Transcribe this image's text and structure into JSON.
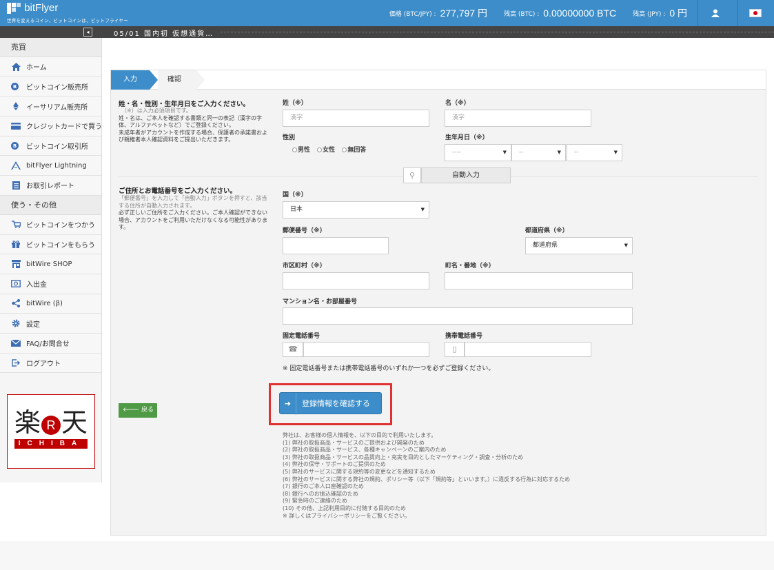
{
  "header": {
    "brand": "bitFlyer",
    "tagline": "世界を変えるコイン、ビットコインは、ビットフライヤー",
    "price_label": "価格 (BTC/JPY) :",
    "price_value": "277,797 円",
    "btc_balance_label": "残高 (BTC) :",
    "btc_balance_value": "0.00000000 BTC",
    "jpy_balance_label": "残高 (JPY) :",
    "jpy_balance_value": "0 円",
    "accent_color": "#3c8dc9"
  },
  "ticker": {
    "toggle_glyph": "◂",
    "text": "05/01 国内初 仮想通貨…"
  },
  "sidebar": {
    "section_trade": "売買",
    "trade_items": [
      {
        "label": "ホーム",
        "icon": "home-icon"
      },
      {
        "label": "ビットコイン販売所",
        "icon": "bitcoin-icon"
      },
      {
        "label": "イーサリアム販売所",
        "icon": "ethereum-icon"
      },
      {
        "label": "クレジットカードで買う",
        "icon": "credit-card-icon"
      },
      {
        "label": "ビットコイン取引所",
        "icon": "bitcoin-icon"
      },
      {
        "label": "bitFlyer Lightning",
        "icon": "lightning-icon"
      },
      {
        "label": "お取引レポート",
        "icon": "report-icon"
      }
    ],
    "section_use": "使う・その他",
    "use_items": [
      {
        "label": "ビットコインをつかう",
        "icon": "cart-icon"
      },
      {
        "label": "ビットコインをもらう",
        "icon": "gift-icon"
      },
      {
        "label": "bitWire SHOP",
        "icon": "shop-icon"
      },
      {
        "label": "入出金",
        "icon": "deposit-icon"
      },
      {
        "label": "bitWire (β)",
        "icon": "share-icon"
      },
      {
        "label": "設定",
        "icon": "gear-icon"
      },
      {
        "label": "FAQ/お問合せ",
        "icon": "mail-icon"
      },
      {
        "label": "ログアウト",
        "icon": "logout-icon"
      }
    ],
    "ad": {
      "kanji_left": "楽",
      "r_mark": "R",
      "kanji_right": "天",
      "sub": "ICHIBA"
    }
  },
  "steps": {
    "step1": "入力",
    "step2": "確認"
  },
  "section_personal": {
    "title": "姓・名・性別・生年月日をご入力ください。",
    "note_required": "（※）は入力必須項目です。",
    "desc1": "姓・名は、ご本人を確認する書類と同一の表記（漢字の字体、アルファベットなど）でご登録ください。",
    "desc2": "未成年者がアカウントを作成する場合、保護者の承諾書および親権者本人確認資料をご提出いただきます。",
    "last_name_label": "姓（※）",
    "last_name_placeholder": "漢字",
    "first_name_label": "名（※）",
    "first_name_placeholder": "漢字",
    "gender_label": "性別",
    "gender_options": [
      "男性",
      "女性",
      "無回答"
    ],
    "birth_label": "生年月日（※）",
    "birth_year": "----",
    "birth_month": "--",
    "birth_day": "--"
  },
  "section_address": {
    "title": "ご住所とお電話番号をご入力ください。",
    "desc1": "「郵便番号」を入力して「自動入力」ボタンを押すと、該当する住所が自動入力されます。",
    "desc2": "必ず正しいご住所をご入力ください。ご本人確認ができない場合、アカウントをご利用いただけなくなる可能性があります。",
    "country_label": "国（※）",
    "country_value": "日本",
    "zip_label": "郵便番号（※）",
    "auto_input_label": "自動入力",
    "prefecture_label": "都道府県（※）",
    "prefecture_value": "都道府県",
    "city_label": "市区町村（※）",
    "town_label": "町名・番地（※）",
    "building_label": "マンション名・お部屋番号",
    "landline_label": "固定電話番号",
    "mobile_label": "携帯電話番号",
    "phone_note": "※ 固定電話番号または携帯電話番号のいずれか一つを必ずご登録ください。"
  },
  "actions": {
    "back_label": "戻る",
    "confirm_label": "登録情報を確認する"
  },
  "privacy": {
    "intro": "弊社は、お客様の個人情報を、以下の目的で利用いたします。",
    "items": [
      "(1) 弊社の取扱商品・サービスのご提供および開発のため",
      "(2) 弊社の取扱商品・サービス、各種キャンペーンのご案内のため",
      "(3) 弊社の取扱商品・サービスの品質向上・充実を目的としたマーケティング・調査・分析のため",
      "(4) 弊社の保守・サポートのご提供のため",
      "(5) 弊社のサービスに関する規約等の変更などを通知するため",
      "(6) 弊社のサービスに関する弊社の規約、ポリシー等（以下「規約等」といいます。）に違反する行為に対応するため",
      "(7) 銀行のご本人口座確認のため",
      "(8) 銀行へのお振込確認のため",
      "(9) 緊急時のご連絡のため",
      "(10) その他、上記利用目的に付随する目的のため"
    ],
    "footer_note": "※ 詳しくはプライバシーポリシーをご覧ください。"
  }
}
